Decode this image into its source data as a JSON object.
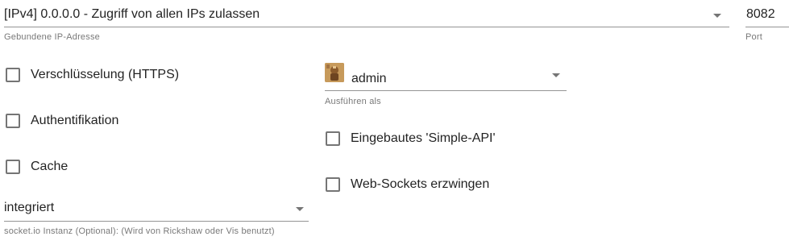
{
  "ip_select": {
    "value": "[IPv4] 0.0.0.0 - Zugriff von allen IPs zulassen",
    "helper": "Gebundene IP-Adresse"
  },
  "port": {
    "value": "8082",
    "helper": "Port"
  },
  "checkboxes": {
    "https": {
      "label": "Verschlüsselung (HTTPS)",
      "checked": false
    },
    "auth": {
      "label": "Authentifikation",
      "checked": false
    },
    "cache": {
      "label": "Cache",
      "checked": false
    },
    "simple_api": {
      "label": "Eingebautes 'Simple-API'",
      "checked": false
    },
    "web_sockets": {
      "label": "Web-Sockets erzwingen",
      "checked": false
    }
  },
  "run_as_select": {
    "value": "admin",
    "helper": "Ausführen als",
    "avatar_icon": "user-avatar-icon"
  },
  "socketio_select": {
    "value": "integriert",
    "helper": "socket.io Instanz (Optional): (Wird von Rickshaw oder Vis benutzt)"
  }
}
